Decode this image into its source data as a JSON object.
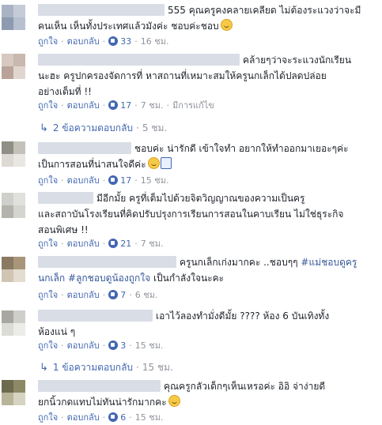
{
  "comments": [
    {
      "lines": [
        "555 คุณครูคงคลายเคลียด ไม่ต้องระแวงว่าจะมี",
        "คนเห็น เห็นทั้งประเทศแล้วมังค่ะ ชอบค่ะชอบ"
      ],
      "like_label": "ถูกใจ",
      "reply_label": "ตอบกลับ",
      "likes": "33",
      "time": "16 ชม."
    },
    {
      "lines": [
        "คล้ายๆว่าจะระแวงนักเรียน",
        "นะฮะ ครูปกครองจัดการที่ หาสถานที่เหมาะสมให้ครูนกเล็กได้ปลดปล่อย",
        "อย่างเต็มที่ !!"
      ],
      "like_label": "ถูกใจ",
      "reply_label": "ตอบกลับ",
      "likes": "17",
      "time": "7 ชม.",
      "edited": "มีการแก้ไข",
      "replies_text": "2 ข้อความตอบกลับ",
      "replies_time": "5 ชม."
    },
    {
      "lines": [
        "ชอบค่ะ น่ารักดี เข้าใจทำ อยากให้ทำออกมาเยอะๆค่ะ",
        "เป็นการสอนที่น่าสนใจดีค่ะ"
      ],
      "like_label": "ถูกใจ",
      "reply_label": "ตอบกลับ",
      "likes": "17",
      "time": "15 ชม."
    },
    {
      "lines": [
        "มีอีกมั้ย ครูที่เต็มไปด้วยจิตวิญญาณของความเป็นครู",
        "และสถาบันโรงเรียนที่คิดปรับปรุงการเรียนการสอนในคาบเรียน ไม่ใช่ธุระกิจ",
        "สอนพิเศษ !!"
      ],
      "like_label": "ถูกใจ",
      "reply_label": "ตอบกลับ",
      "likes": "21",
      "time": "7 ชม."
    },
    {
      "line1": "ครูนกเล็กเก่งมากคะ ..ชอบๆๆ",
      "hashtag1": "#แม่ชอบดูครู",
      "hashtag2": "นกเล็ก #ลูกชอบดูน้องถูกใจ",
      "line2_rest": " เป็นกำลังใจนะคะ",
      "like_label": "ถูกใจ",
      "reply_label": "ตอบกลับ",
      "likes": "7",
      "time": "6 ชม."
    },
    {
      "lines": [
        "เอาไว้ลองทำมั่งดีมั้ย ???? ห้อง 6 บันเทิงทั้ง",
        "ห้องแน่ ๆ"
      ],
      "like_label": "ถูกใจ",
      "reply_label": "ตอบกลับ",
      "likes": "3",
      "time": "15 ชม.",
      "replies_text": "1 ข้อความตอบกลับ",
      "replies_time": "15 ชม."
    },
    {
      "lines": [
        "คุณครูกลัวเด็กๆเห็นเหรอค่ะ อิอิ จ่าง่ายดี",
        "ยกนิ้วกดแทบไม่ทันน่ารักมากคะ"
      ],
      "like_label": "ถูกใจ",
      "reply_label": "ตอบกลับ",
      "likes": "6",
      "time": "15 ชม."
    }
  ],
  "colors": {
    "link": "#4267b2",
    "meta": "#90949c",
    "text": "#1d2129",
    "redact": "#d8dde6"
  },
  "icons": {
    "like": "like-badge-icon",
    "smile": "smile-emoji-icon",
    "thumbs": "thumbs-up-emoji-icon",
    "reply_arrow": "reply-arrow-icon"
  },
  "reply_arrow": "↳"
}
